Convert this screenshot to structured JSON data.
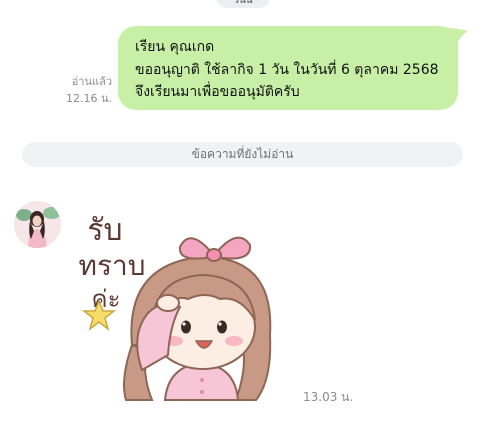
{
  "date_divider": "วันนี้",
  "outgoing": {
    "status": "อ่านแล้ว",
    "time": "12.16 น.",
    "lines": [
      "เรียน คุณเกด",
      "ขออนุญาติ ใช้ลากิจ 1 วัน  ในวันที่ 6 ตุลาคม 2568",
      "จึงเรียนมาเพื่อขออนุมัติครับ"
    ]
  },
  "unread_divider": "ข้อความที่ยังไม่อ่าน",
  "incoming": {
    "sticker_text": [
      "รับ",
      "ทราบ",
      "ค่ะ"
    ],
    "time": "13.03 น."
  },
  "colors": {
    "outgoing_bubble": "#c7f0a6",
    "divider_bg": "#f1f2f4",
    "sticker_bow": "#f4a5bf",
    "sticker_hair": "#c89a86",
    "sticker_shirt": "#f6c5d6",
    "sticker_star": "#f6dd6a"
  }
}
